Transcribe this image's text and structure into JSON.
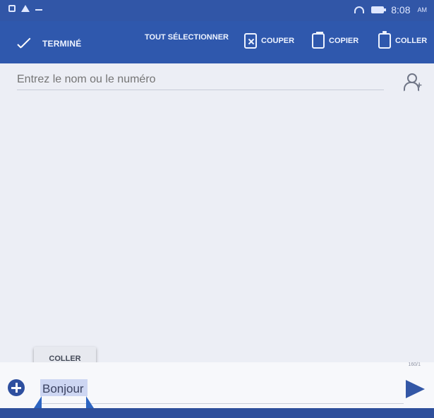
{
  "status_bar": {
    "time": "8:08",
    "ampm": "AM"
  },
  "action_bar": {
    "done_label": "TERMINÉ",
    "select_all_label": "TOUT SÉLECTIONNER",
    "cut_label": "COUPER",
    "copy_label": "COPIER",
    "paste_label": "COLLER"
  },
  "recipient": {
    "placeholder": "Entrez le nom ou le numéro"
  },
  "compose": {
    "paste_popup_label": "COLLER",
    "message_value": "Bonjour",
    "character_counter": "160/1"
  },
  "icons": {
    "add": "add-icon",
    "send": "send-icon",
    "contact": "contact-icon"
  },
  "colors": {
    "primary_blue": "#2f58ad",
    "background": "#eceef5"
  }
}
